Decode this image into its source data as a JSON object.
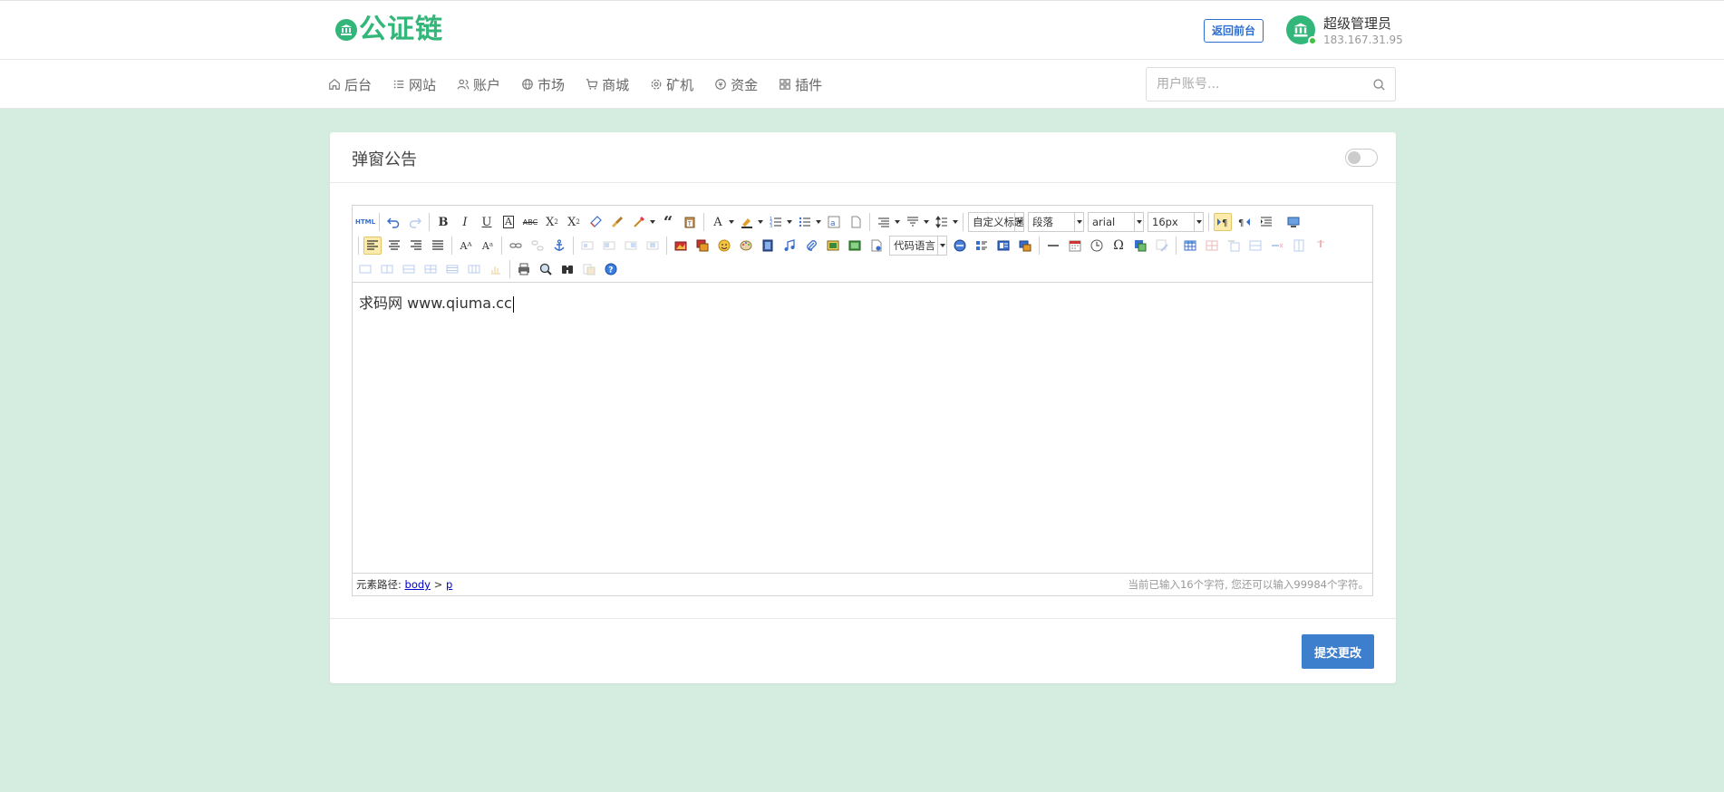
{
  "brand": {
    "name": "公证链",
    "color": "#33b679"
  },
  "header": {
    "back_label": "返回前台",
    "user": {
      "name": "超级管理员",
      "ip": "183.167.31.95"
    }
  },
  "nav": {
    "items": [
      {
        "label": "后台",
        "icon": "home-icon"
      },
      {
        "label": "网站",
        "icon": "list-icon"
      },
      {
        "label": "账户",
        "icon": "users-icon"
      },
      {
        "label": "市场",
        "icon": "globe-icon"
      },
      {
        "label": "商城",
        "icon": "cart-icon"
      },
      {
        "label": "矿机",
        "icon": "gear-icon"
      },
      {
        "label": "资金",
        "icon": "coin-icon"
      },
      {
        "label": "插件",
        "icon": "grid-icon"
      }
    ],
    "search_placeholder": "用户账号..."
  },
  "card": {
    "title": "弹窗公告",
    "toggle_on": false
  },
  "editor": {
    "toolbar": {
      "combo_custom_heading": "自定义标题",
      "combo_paragraph": "段落",
      "combo_font": "arial",
      "combo_size": "16px",
      "combo_code": "代码语言",
      "html_label": "HTML"
    },
    "content": "求码网 www.qiuma.cc",
    "status": {
      "path_label": "元素路径:",
      "path_body": "body",
      "path_sep": ">",
      "path_p": "p",
      "count_text": "当前已输入16个字符, 您还可以输入99984个字符。"
    }
  },
  "submit_label": "提交更改"
}
